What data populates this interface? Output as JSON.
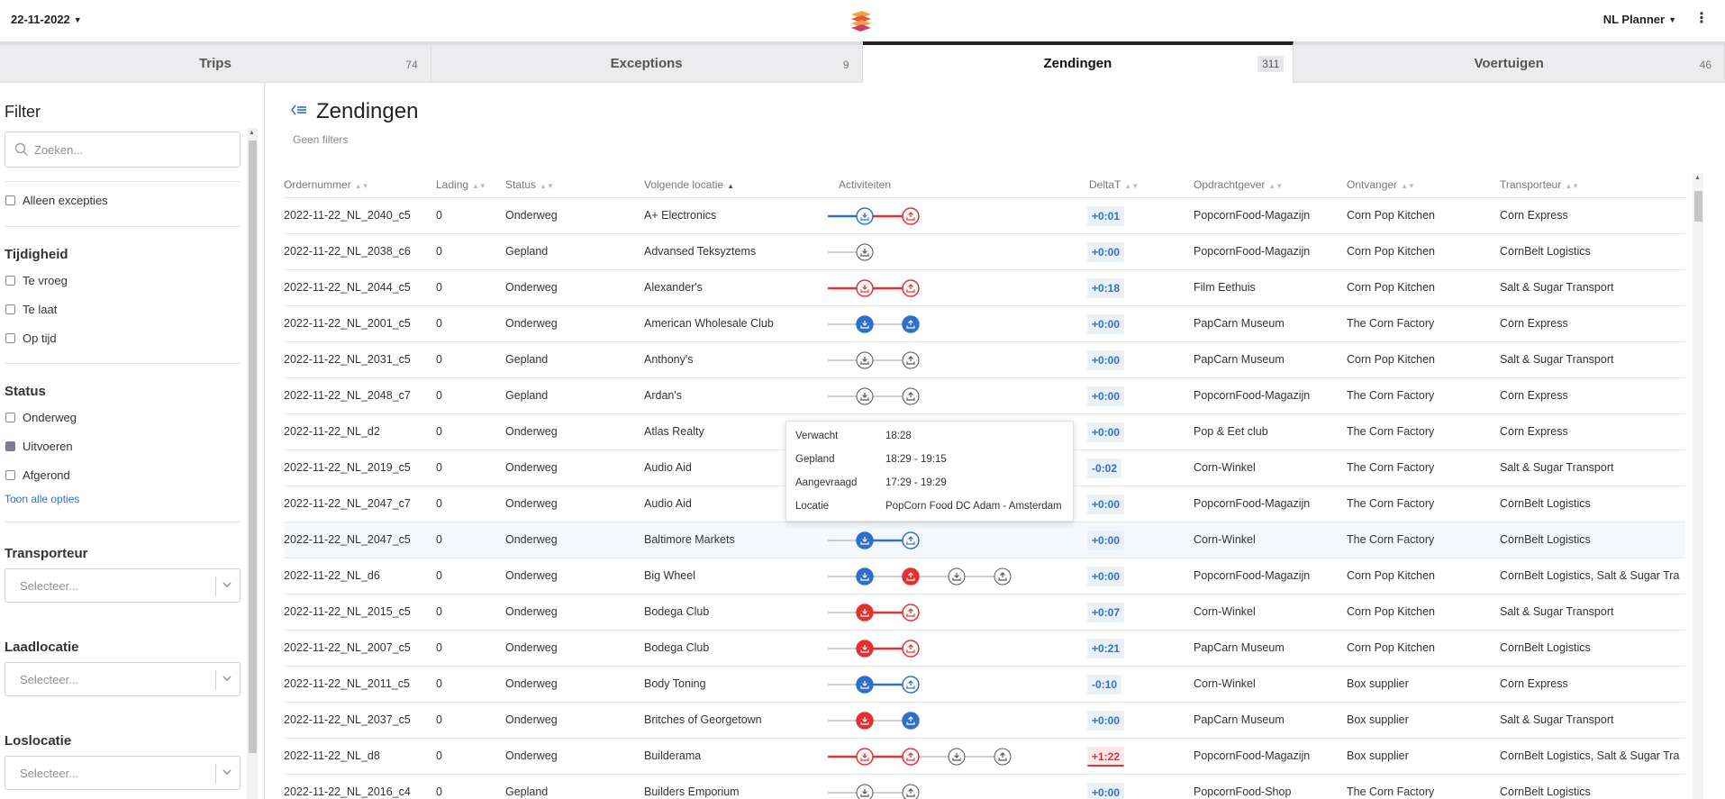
{
  "header": {
    "date": "22-11-2022",
    "user": "NL Planner"
  },
  "tabs": [
    {
      "label": "Trips",
      "count": "74",
      "active": false
    },
    {
      "label": "Exceptions",
      "count": "9",
      "active": false
    },
    {
      "label": "Zendingen",
      "count": "311",
      "active": true
    },
    {
      "label": "Voertuigen",
      "count": "46",
      "active": false
    }
  ],
  "sidebar": {
    "title": "Filter",
    "search_placeholder": "Zoeken...",
    "only_exceptions": "Alleen excepties",
    "timeliness_title": "Tijdigheid",
    "timeliness": [
      "Te vroeg",
      "Te laat",
      "Op tijd"
    ],
    "status_title": "Status",
    "status": [
      {
        "label": "Onderweg",
        "checked": false
      },
      {
        "label": "Uitvoeren",
        "checked": true
      },
      {
        "label": "Afgerond",
        "checked": false
      }
    ],
    "show_all": "Toon alle opties",
    "carrier_title": "Transporteur",
    "load_title": "Laadlocatie",
    "unload_title": "Loslocatie",
    "select_placeholder": "Selecteer..."
  },
  "main": {
    "title": "Zendingen",
    "subtitle": "Geen filters"
  },
  "table": {
    "columns": [
      "Ordernummer",
      "Lading",
      "Status",
      "Volgende locatie",
      "Activiteiten",
      "DeltaT",
      "Opdrachtgever",
      "Ontvanger",
      "Transporteur"
    ],
    "rows": [
      {
        "order": "2022-11-22_NL_2040_c5",
        "load": "0",
        "status": "Onderweg",
        "next": "A+ Electronics",
        "delta": "+0:01",
        "delta_state": "ok",
        "client": "PopcornFood-Magazijn",
        "receiver": "Corn Pop Kitchen",
        "carrier": "Corn Express",
        "activities": [
          {
            "type": "load",
            "state": "blue-outline"
          },
          {
            "type": "unload",
            "state": "red-outline"
          }
        ],
        "links": [
          "blue",
          "red"
        ]
      },
      {
        "order": "2022-11-22_NL_2038_c6",
        "load": "0",
        "status": "Gepland",
        "next": "Advansed Teksyztems",
        "delta": "+0:00",
        "delta_state": "ok",
        "client": "PopcornFood-Magazijn",
        "receiver": "Corn Pop Kitchen",
        "carrier": "CornBelt Logistics",
        "activities": [
          {
            "type": "load",
            "state": "grey-outline"
          }
        ],
        "links": [
          "grey"
        ]
      },
      {
        "order": "2022-11-22_NL_2044_c5",
        "load": "0",
        "status": "Onderweg",
        "next": "Alexander's",
        "delta": "+0:18",
        "delta_state": "ok",
        "client": "Film Eethuis",
        "receiver": "Corn Pop Kitchen",
        "carrier": "Salt & Sugar Transport",
        "activities": [
          {
            "type": "load",
            "state": "red-outline"
          },
          {
            "type": "unload",
            "state": "red-outline"
          }
        ],
        "links": [
          "red",
          "red"
        ]
      },
      {
        "order": "2022-11-22_NL_2001_c5",
        "load": "0",
        "status": "Onderweg",
        "next": "American Wholesale Club",
        "delta": "+0:00",
        "delta_state": "ok",
        "client": "PapCarn Museum",
        "receiver": "The Corn Factory",
        "carrier": "Corn Express",
        "activities": [
          {
            "type": "load",
            "state": "blue-fill"
          },
          {
            "type": "unload",
            "state": "blue-fill"
          }
        ],
        "links": [
          "grey",
          "grey"
        ]
      },
      {
        "order": "2022-11-22_NL_2031_c5",
        "load": "0",
        "status": "Gepland",
        "next": "Anthony's",
        "delta": "+0:00",
        "delta_state": "ok",
        "client": "PapCarn Museum",
        "receiver": "Corn Pop Kitchen",
        "carrier": "Salt & Sugar Transport",
        "activities": [
          {
            "type": "load",
            "state": "grey-outline"
          },
          {
            "type": "unload",
            "state": "grey-outline"
          }
        ],
        "links": [
          "grey",
          "grey"
        ]
      },
      {
        "order": "2022-11-22_NL_2048_c7",
        "load": "0",
        "status": "Gepland",
        "next": "Ardan's",
        "delta": "+0:00",
        "delta_state": "ok",
        "client": "PopcornFood-Magazijn",
        "receiver": "The Corn Factory",
        "carrier": "Corn Express",
        "activities": [
          {
            "type": "load",
            "state": "grey-outline"
          },
          {
            "type": "unload",
            "state": "grey-outline"
          }
        ],
        "links": [
          "grey",
          "grey"
        ]
      },
      {
        "order": "2022-11-22_NL_d2",
        "load": "0",
        "status": "Onderweg",
        "next": "Atlas Realty",
        "delta": "+0:00",
        "delta_state": "ok",
        "client": "Pop & Eet club",
        "receiver": "The Corn Factory",
        "carrier": "Corn Express",
        "activities": [],
        "links": []
      },
      {
        "order": "2022-11-22_NL_2019_c5",
        "load": "0",
        "status": "Onderweg",
        "next": "Audio Aid",
        "delta": "-0:02",
        "delta_state": "ok",
        "client": "Corn-Winkel",
        "receiver": "The Corn Factory",
        "carrier": "Salt & Sugar Transport",
        "activities": [],
        "links": []
      },
      {
        "order": "2022-11-22_NL_2047_c7",
        "load": "0",
        "status": "Onderweg",
        "next": "Audio Aid",
        "delta": "+0:00",
        "delta_state": "ok",
        "client": "PopcornFood-Magazijn",
        "receiver": "The Corn Factory",
        "carrier": "CornBelt Logistics",
        "activities": [],
        "links": []
      },
      {
        "order": "2022-11-22_NL_2047_c5",
        "load": "0",
        "status": "Onderweg",
        "next": "Baltimore Markets",
        "delta": "+0:00",
        "delta_state": "ok",
        "client": "Corn-Winkel",
        "receiver": "The Corn Factory",
        "carrier": "CornBelt Logistics",
        "activities": [
          {
            "type": "load",
            "state": "blue-fill"
          },
          {
            "type": "unload",
            "state": "blue-outline"
          }
        ],
        "links": [
          "grey",
          "blue"
        ],
        "highlight": true
      },
      {
        "order": "2022-11-22_NL_d6",
        "load": "0",
        "status": "Onderweg",
        "next": "Big Wheel",
        "delta": "+0:00",
        "delta_state": "ok",
        "client": "PopcornFood-Magazijn",
        "receiver": "Corn Pop Kitchen",
        "carrier": "CornBelt Logistics, Salt & Sugar Transport",
        "activities": [
          {
            "type": "load",
            "state": "blue-fill"
          },
          {
            "type": "unload",
            "state": "red-fill"
          },
          {
            "type": "load",
            "state": "grey-outline"
          },
          {
            "type": "unload",
            "state": "grey-outline"
          }
        ],
        "links": [
          "grey",
          "grey",
          "grey",
          "grey"
        ]
      },
      {
        "order": "2022-11-22_NL_2015_c5",
        "load": "0",
        "status": "Onderweg",
        "next": "Bodega Club",
        "delta": "+0:07",
        "delta_state": "ok",
        "client": "Corn-Winkel",
        "receiver": "Corn Pop Kitchen",
        "carrier": "Salt & Sugar Transport",
        "activities": [
          {
            "type": "load",
            "state": "red-fill"
          },
          {
            "type": "unload",
            "state": "red-outline"
          }
        ],
        "links": [
          "grey",
          "red"
        ]
      },
      {
        "order": "2022-11-22_NL_2007_c5",
        "load": "0",
        "status": "Onderweg",
        "next": "Bodega Club",
        "delta": "+0:21",
        "delta_state": "ok",
        "client": "PapCarn Museum",
        "receiver": "Corn Pop Kitchen",
        "carrier": "CornBelt Logistics",
        "activities": [
          {
            "type": "load",
            "state": "red-fill"
          },
          {
            "type": "unload",
            "state": "red-outline"
          }
        ],
        "links": [
          "grey",
          "red"
        ]
      },
      {
        "order": "2022-11-22_NL_2011_c5",
        "load": "0",
        "status": "Onderweg",
        "next": "Body Toning",
        "delta": "-0:10",
        "delta_state": "ok",
        "client": "Corn-Winkel",
        "receiver": "Box supplier",
        "carrier": "Corn Express",
        "activities": [
          {
            "type": "load",
            "state": "blue-fill"
          },
          {
            "type": "unload",
            "state": "blue-outline"
          }
        ],
        "links": [
          "grey",
          "blue"
        ]
      },
      {
        "order": "2022-11-22_NL_2037_c5",
        "load": "0",
        "status": "Onderweg",
        "next": "Britches of Georgetown",
        "delta": "+0:00",
        "delta_state": "ok",
        "client": "PapCarn Museum",
        "receiver": "Box supplier",
        "carrier": "Salt & Sugar Transport",
        "activities": [
          {
            "type": "load",
            "state": "red-fill"
          },
          {
            "type": "unload",
            "state": "blue-fill"
          }
        ],
        "links": [
          "grey",
          "grey"
        ]
      },
      {
        "order": "2022-11-22_NL_d8",
        "load": "0",
        "status": "Onderweg",
        "next": "Builderama",
        "delta": "+1:22",
        "delta_state": "late",
        "client": "PopcornFood-Magazijn",
        "receiver": "Box supplier",
        "carrier": "CornBelt Logistics, Salt & Sugar Transport",
        "activities": [
          {
            "type": "load",
            "state": "red-outline"
          },
          {
            "type": "unload",
            "state": "red-outline"
          },
          {
            "type": "load",
            "state": "grey-outline"
          },
          {
            "type": "unload",
            "state": "grey-outline"
          }
        ],
        "links": [
          "red",
          "red",
          "grey",
          "grey"
        ]
      },
      {
        "order": "2022-11-22_NL_2016_c4",
        "load": "0",
        "status": "Gepland",
        "next": "Builders Emporium",
        "delta": "+0:00",
        "delta_state": "ok",
        "client": "PopcornFood-Shop",
        "receiver": "The Corn Factory",
        "carrier": "CornBelt Logistics",
        "activities": [
          {
            "type": "load",
            "state": "grey-outline"
          },
          {
            "type": "unload",
            "state": "grey-outline"
          }
        ],
        "links": [
          "grey",
          "grey"
        ]
      }
    ]
  },
  "tooltip": {
    "rows": [
      {
        "key": "Verwacht",
        "value": "18:28"
      },
      {
        "key": "Gepland",
        "value": "18:29 - 19:15"
      },
      {
        "key": "Aangevraagd",
        "value": "17:29 - 19:29"
      },
      {
        "key": "Locatie",
        "value": "PopCorn Food DC Adam - Amsterdam"
      }
    ]
  },
  "colors": {
    "blue": "#2f6fcb",
    "red": "#e53030",
    "grey": "#bdbdbd",
    "accent_tab": "#222222"
  },
  "icons": {
    "date_caret": "caret-down-icon",
    "logo": "planner-logo",
    "kebab": "more-vertical-icon",
    "search": "search-icon",
    "back": "collapse-left-icon",
    "load": "download-icon",
    "unload": "upload-icon"
  }
}
